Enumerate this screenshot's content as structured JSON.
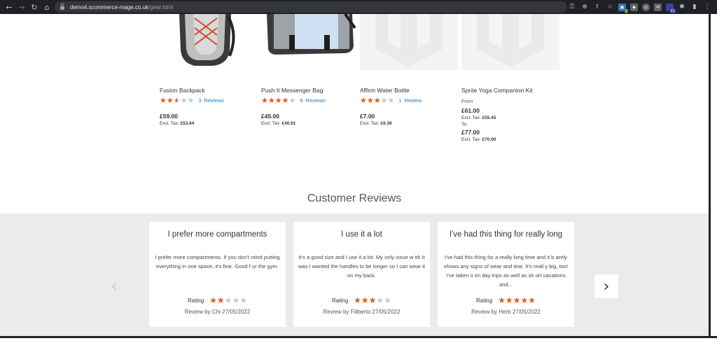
{
  "browser": {
    "url_host": "demo4.scommerce-mage.co.uk",
    "url_path": "/gear.html",
    "ext_badge_1": "1",
    "ext_badge_2": "21"
  },
  "products": [
    {
      "name": "Fusion Backpack",
      "rating": 2.5,
      "review_count": "3",
      "review_label": "Reviews",
      "price": "£59.00",
      "tax_label": "Excl. Tax:",
      "tax_value": "£53.64"
    },
    {
      "name": "Push It Messenger Bag",
      "rating": 4,
      "review_count": "6",
      "review_label": "Reviews",
      "price": "£45.00",
      "tax_label": "Excl. Tax:",
      "tax_value": "£40.91"
    },
    {
      "name": "Affirm Water Bottle",
      "rating": 3,
      "review_count": "1",
      "review_label": "Review",
      "price": "£7.00",
      "tax_label": "Excl. Tax:",
      "tax_value": "£6.36"
    },
    {
      "name": "Sprite Yoga Companion Kit",
      "from_label": "From",
      "price_from": "£61.00",
      "tax_label": "Excl. Tax:",
      "tax_from": "£55.45",
      "to_label": "To",
      "price_to": "£77.00",
      "tax_to": "£70.00"
    }
  ],
  "reviews_section": {
    "title": "Customer Reviews",
    "rating_label": "Rating",
    "cards": [
      {
        "title": "I prefer more compartments",
        "body": "I prefer more compartments. If you don't mind putting everything in one space, it's fine. Good f or the gym.",
        "rating": 2,
        "byline": "Review by Chi 27/05/2022"
      },
      {
        "title": "I use it a lot",
        "body": "It's a good size and I use it a lot. My only issue w ith it was I wanted the handles to be longer so I can wear it on my back.",
        "rating": 3,
        "byline": "Review by Filiberto 27/05/2022"
      },
      {
        "title": "I've had this thing for really long",
        "body": "I've had this thing for a really long time and it b arely shows any signs of wear and tear. It's reall y big, too! I've taken it on day trips as well as sh ort vacations and...",
        "rating": 5,
        "byline": "Review by Herb 27/05/2022"
      }
    ]
  },
  "colors": {
    "star_active": "#e0591a",
    "star_inactive": "#c7c7c7",
    "link": "#1979c3",
    "band": "#ebebeb"
  }
}
